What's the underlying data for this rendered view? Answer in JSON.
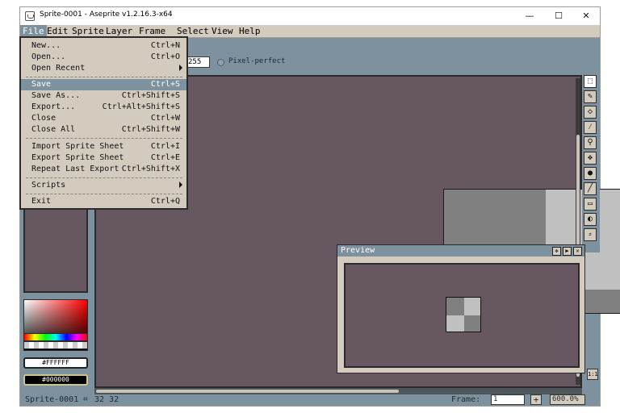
{
  "window": {
    "title": "Sprite-0001 - Aseprite v1.2.16.3-x64",
    "controls": {
      "minimize": "—",
      "maximize": "☐",
      "close": "✕"
    }
  },
  "menubar": [
    "File",
    "Edit",
    "Sprite",
    "Layer",
    "Frame",
    "Select",
    "View",
    "Help"
  ],
  "file_menu": {
    "items": [
      {
        "label": "New...",
        "shortcut": "Ctrl+N"
      },
      {
        "label": "Open...",
        "shortcut": "Ctrl+O"
      },
      {
        "label": "Open Recent",
        "shortcut": ""
      },
      {
        "label": "Save",
        "shortcut": "Ctrl+S"
      },
      {
        "label": "Save As...",
        "shortcut": "Ctrl+Shift+S"
      },
      {
        "label": "Export...",
        "shortcut": "Ctrl+Alt+Shift+S"
      },
      {
        "label": "Close",
        "shortcut": "Ctrl+W"
      },
      {
        "label": "Close All",
        "shortcut": "Ctrl+Shift+W"
      },
      {
        "label": "Import Sprite Sheet",
        "shortcut": "Ctrl+I"
      },
      {
        "label": "Export Sprite Sheet",
        "shortcut": "Ctrl+E"
      },
      {
        "label": "Repeat Last Export",
        "shortcut": "Ctrl+Shift+X"
      },
      {
        "label": "Scripts",
        "shortcut": ""
      },
      {
        "label": "Exit",
        "shortcut": "Ctrl+Q"
      }
    ],
    "selected": "Save"
  },
  "toolbar_options": {
    "opacity_value": "255",
    "pixel_perfect_label": "Pixel-perfect"
  },
  "colors": {
    "foreground_hex": "#FFFFFF",
    "background_hex": "#000000",
    "ui_accent": "#7d929e",
    "ui_panel": "#d3cbbe",
    "canvas_bg": "#665761"
  },
  "tools": [
    "marquee-icon",
    "pencil-icon",
    "eraser-icon",
    "eyedropper-icon",
    "zoom-icon",
    "move-icon",
    "paint-bucket-icon",
    "line-icon",
    "rectangle-icon",
    "ellipse-icon",
    "blur-icon"
  ],
  "preview": {
    "title": "Preview"
  },
  "statusbar": {
    "sprite_name": "Sprite-0001",
    "dimensions": "32 32",
    "frame_label": "Frame:",
    "frame_value": "1",
    "add_frame": "+",
    "zoom": "600.0%"
  }
}
